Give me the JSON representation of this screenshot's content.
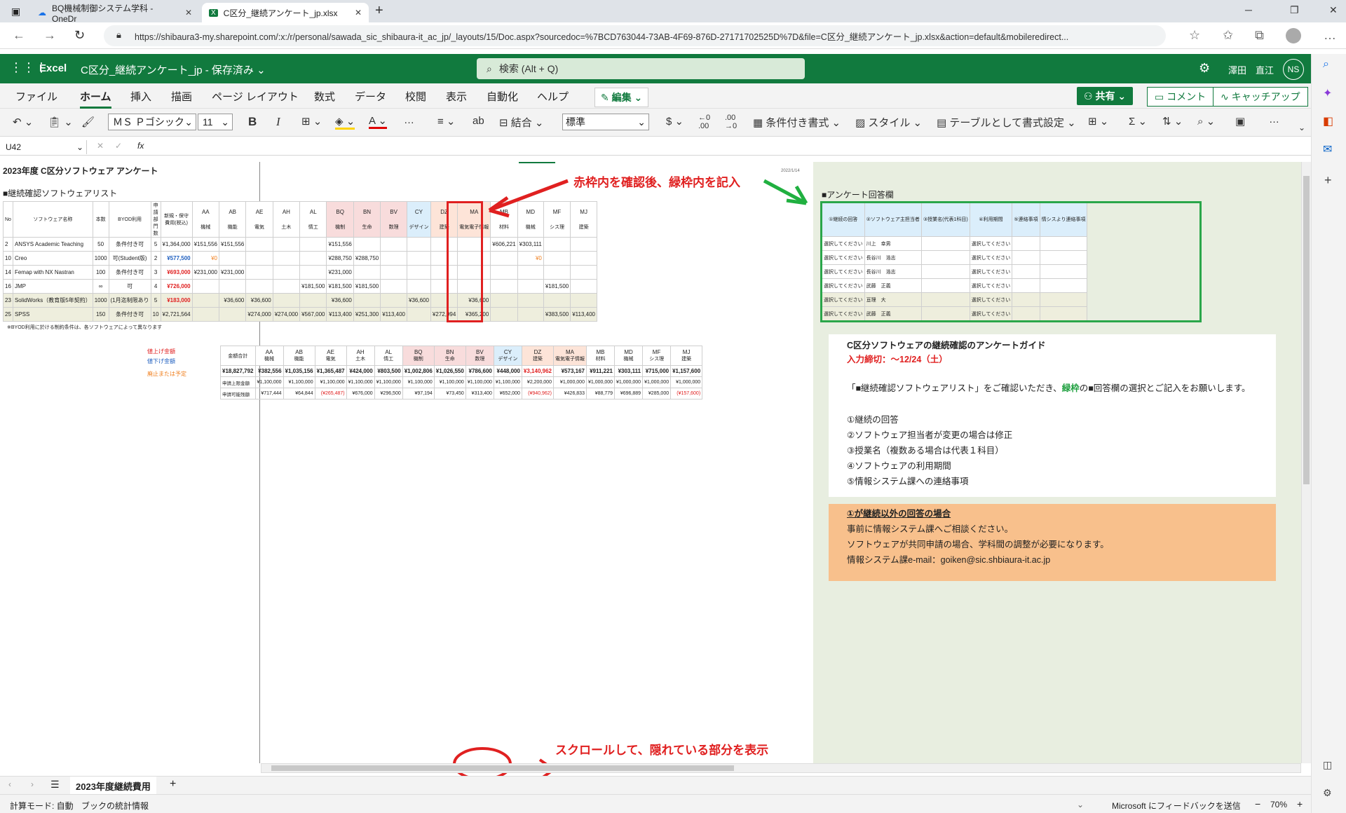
{
  "browser": {
    "tabs": [
      {
        "label": "BQ機械制御システム学科 - OneDr"
      },
      {
        "label": "C区分_継続アンケート_jp.xlsx"
      }
    ],
    "url": "https://shibaura3-my.sharepoint.com/:x:/r/personal/sawada_sic_shibaura-it_ac_jp/_layouts/15/Doc.aspx?sourcedoc=%7BCD763044-73AB-4F69-876D-27171702525D%7D&file=C区分_継続アンケート_jp.xlsx&action=default&mobileredirect..."
  },
  "excel": {
    "app": "Excel",
    "doc_title": "C区分_継続アンケート_jp - 保存済み ⌄",
    "search": "検索 (Alt + Q)",
    "user": "澤田　直江",
    "initials": "NS",
    "menus": [
      "ファイル",
      "ホーム",
      "挿入",
      "描画",
      "ページ レイアウト",
      "数式",
      "データ",
      "校閲",
      "表示",
      "自動化",
      "ヘルプ"
    ],
    "edit": "✎ 編集 ⌄",
    "share": "共有 ⌄",
    "comment": "コメント",
    "catchup": "キャッチアップ",
    "font": "ＭＳ Ｐゴシック",
    "size": "11",
    "merge": "結合",
    "numfmt": "標準",
    "cond": "条件付き書式",
    "style": "スタイル",
    "tablefmt": "テーブルとして書式設定",
    "cellref": "U42",
    "fx": "fx"
  },
  "sheet": {
    "title": "2023年度 C区分ソフトウェア アンケート",
    "date": "2022/1/14",
    "list_title": "■継続確認ソフトウェアリスト",
    "answer_title": "■アンケート回答欄",
    "left_headers": [
      "No",
      "ソフトウェア名称",
      "本数",
      "BYOD利用",
      "申請部門数",
      "新規・保守費用(税込)"
    ],
    "dept_codes": [
      "AA",
      "AB",
      "AE",
      "AH",
      "AL",
      "BQ",
      "BN",
      "BV",
      "CY",
      "DZ",
      "MA",
      "MB",
      "MD",
      "MF",
      "MJ"
    ],
    "dept_names": [
      "機械",
      "機能",
      "電気",
      "土木",
      "情工",
      "機制",
      "生命",
      "数理",
      "デザイン",
      "建築",
      "電気電子情報",
      "材料",
      "機械",
      "シス理",
      "建築"
    ],
    "rows": [
      {
        "no": "2",
        "name": "ANSYS Academic Teaching",
        "qty": "50",
        "byod": "条件付き可",
        "n": "5",
        "cost": "¥1,364,000",
        "c": [
          "¥151,556",
          "¥151,556",
          "",
          "",
          "",
          "¥151,556",
          "",
          "",
          "",
          "",
          "",
          "¥606,221",
          "¥303,111",
          "",
          ""
        ]
      },
      {
        "no": "10",
        "name": "Creo",
        "qty": "1000",
        "byod": "可(Student版)",
        "n": "2",
        "cost": "¥577,500",
        "c": [
          "¥0",
          "",
          "",
          "",
          "",
          "¥288,750",
          "¥288,750",
          "",
          "",
          "",
          "",
          "",
          "¥0",
          "",
          ""
        ]
      },
      {
        "no": "14",
        "name": "Femap with NX Nastran",
        "qty": "100",
        "byod": "条件付き可",
        "n": "3",
        "cost": "¥693,000",
        "c": [
          "¥231,000",
          "¥231,000",
          "",
          "",
          "",
          "¥231,000",
          "",
          "",
          "",
          "",
          "",
          "",
          "",
          "",
          ""
        ]
      },
      {
        "no": "16",
        "name": "JMP",
        "qty": "∞",
        "byod": "可",
        "n": "4",
        "cost": "¥726,000",
        "c": [
          "",
          "",
          "",
          "",
          "¥181,500",
          "¥181,500",
          "¥181,500",
          "",
          "",
          "",
          "",
          "",
          "",
          "¥181,500",
          ""
        ]
      },
      {
        "no": "23",
        "name": "SolidWorks（教育版5年契約）",
        "qty": "1000",
        "byod": "(1月迄制限あり",
        "n": "5",
        "cost": "¥183,000",
        "c": [
          "",
          "¥36,600",
          "¥36,600",
          "",
          "",
          "¥36,600",
          "",
          "",
          "¥36,600",
          "",
          "¥36,600",
          "",
          "",
          "",
          ""
        ]
      },
      {
        "no": "25",
        "name": "SPSS",
        "qty": "150",
        "byod": "条件付き可",
        "n": "10",
        "cost": "¥2,721,564",
        "c": [
          "",
          "",
          "¥274,000",
          "¥274,000",
          "¥567,000",
          "¥113,400",
          "¥251,300",
          "¥113,400",
          "",
          "¥272,994",
          "¥365,200",
          "",
          "",
          "¥383,500",
          "¥113,400"
        ]
      }
    ],
    "note": "※BYOD利用に於ける制約条件は、各ソフトウェアによって異なります",
    "answer_headers": [
      "①継続の回答",
      "②ソフトウェア主担当者",
      "③授業名(代表1科目)",
      "④利用期間",
      "⑤連絡事項",
      "情シスより連絡事項"
    ],
    "answers": [
      [
        "選択してください",
        "川上　幸男",
        "",
        "選択してください",
        ""
      ],
      [
        "選択してください",
        "長谷川　浩志",
        "",
        "選択してください",
        ""
      ],
      [
        "選択してください",
        "長谷川　浩志",
        "",
        "選択してください",
        ""
      ],
      [
        "選択してください",
        "武藤　正義",
        "",
        "選択してください",
        ""
      ],
      [
        "選択してください",
        "亘理　大",
        "",
        "選択してください",
        ""
      ],
      [
        "選択してください",
        "武藤　正義",
        "",
        "選択してください",
        ""
      ]
    ],
    "legend": [
      "値上げ金額",
      "値下げ金額",
      "廃止または予定"
    ],
    "sum_labels": [
      "金額合計",
      "申請上限金額",
      "申請可能残額"
    ],
    "sum_total": [
      "¥18,827,792",
      "¥382,556",
      "¥1,035,156",
      "¥1,365,487",
      "¥424,000",
      "¥803,500",
      "¥1,002,806",
      "¥1,026,550",
      "¥786,600",
      "¥448,000",
      "¥3,140,962",
      "¥573,167",
      "¥911,221",
      "¥303,111",
      "¥715,000",
      "¥1,157,600"
    ],
    "sum_limit": [
      "",
      "¥1,100,000",
      "¥1,100,000",
      "¥1,100,000",
      "¥1,100,000",
      "¥1,100,000",
      "¥1,100,000",
      "¥1,100,000",
      "¥1,100,000",
      "¥1,100,000",
      "¥2,200,000",
      "¥1,000,000",
      "¥1,000,000",
      "¥1,000,000",
      "¥1,000,000",
      "¥1,000,000"
    ],
    "sum_remain": [
      "",
      "¥717,444",
      "¥64,844",
      "(¥265,487)",
      "¥676,000",
      "¥296,500",
      "¥97,194",
      "¥73,450",
      "¥313,400",
      "¥652,000",
      "(¥940,962)",
      "¥426,833",
      "¥88,779",
      "¥696,889",
      "¥285,000",
      "(¥157,600)"
    ],
    "guide_title": "C区分ソフトウェアの継続確認のアンケートガイド",
    "guide_deadline": "入力締切：～12/24（土）",
    "guide_text": "「■継続確認ソフトウェアリスト」をご確認いただき、",
    "guide_green": "緑枠",
    "guide_text2": "の■回答欄の選択とご記入をお願いします。",
    "guide_items": [
      "①継続の回答",
      "②ソフトウェア担当者が変更の場合は修正",
      "③授業名（複数ある場合は代表１科目）",
      "④ソフトウェアの利用期間",
      "⑤情報システム課への連絡事項"
    ],
    "note_title": "①が継続以外の回答の場合",
    "note_lines": [
      "事前に情報システム課へご相談ください。",
      "ソフトウェアが共同申請の場合、学科間の調整が必要になります。",
      "情報システム課e-mail：goiken@sic.shbiaura-it.ac.jp"
    ]
  },
  "annotations": {
    "top": "赤枠内を確認後、緑枠内を記入",
    "bottom": "スクロールして、隠れている部分を表示"
  },
  "bottom": {
    "sheet_tab": "2023年度継続費用",
    "status_left": "計算モード: 自動",
    "status_stats": "ブックの統計情報",
    "feedback": "Microsoft にフィードバックを送信",
    "zoom": "70%"
  }
}
